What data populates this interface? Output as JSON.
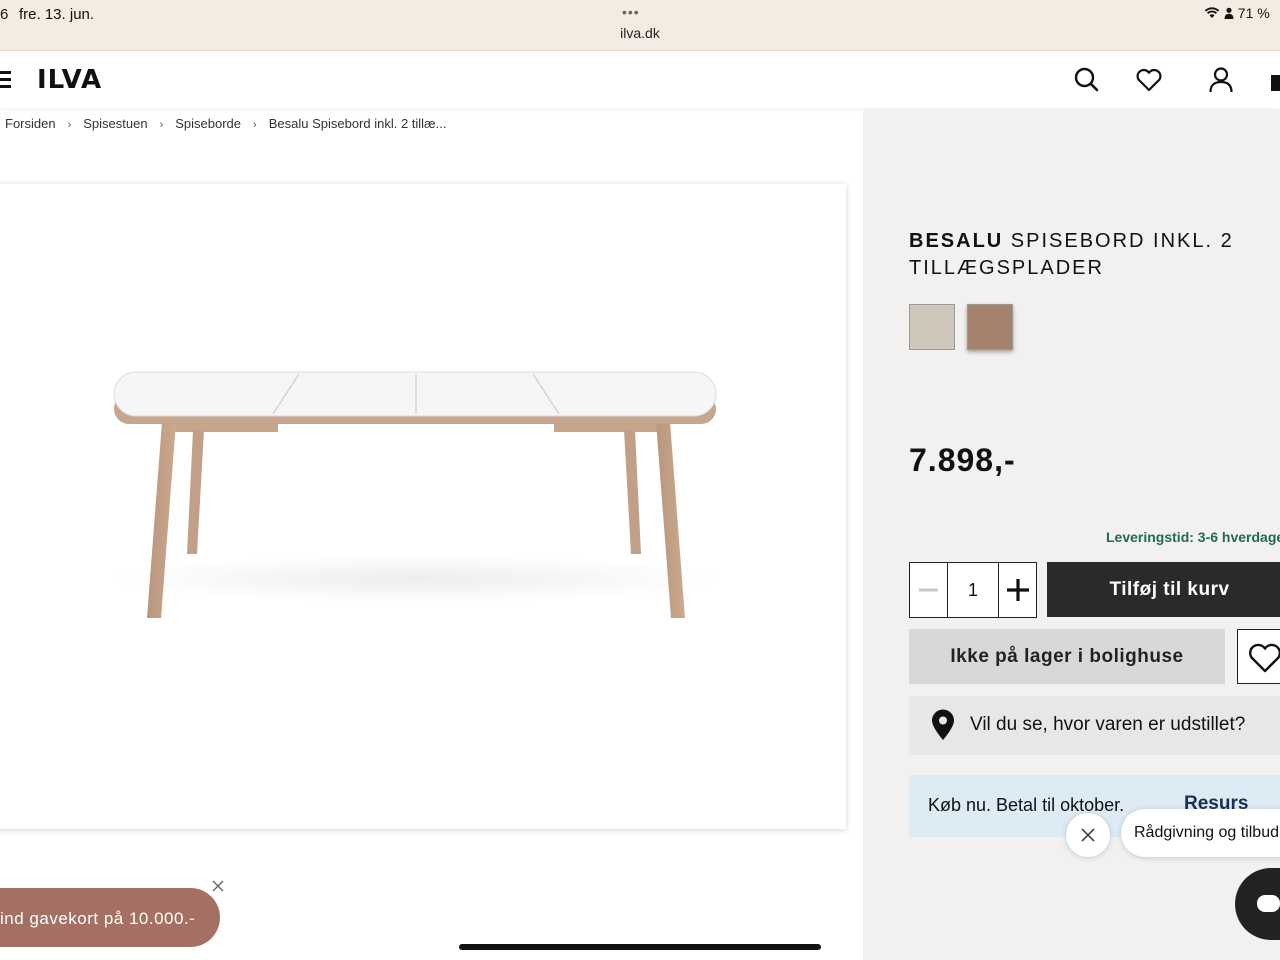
{
  "status_bar": {
    "time_fragment": "6",
    "date": "fre. 13. jun.",
    "tab_dots": "•••",
    "url": "ilva.dk",
    "battery": "71 %"
  },
  "header": {
    "logo_text": "ILVA",
    "icons": [
      "menu-icon",
      "search-icon",
      "heart-icon",
      "user-icon",
      "cart-icon"
    ]
  },
  "breadcrumb": [
    "Forsiden",
    "Spisestuen",
    "Spiseborde",
    "Besalu Spisebord inkl. 2 tillæ..."
  ],
  "breadcrumb_separator": "›",
  "product": {
    "brand": "BESALU",
    "title_rest": "SPISEBORD INKL. 2 TILLÆGSPLADER",
    "swatches": [
      {
        "name": "light",
        "color": "#cfc6ba"
      },
      {
        "name": "oak",
        "color": "#a4826d"
      }
    ],
    "price": "7.898,-",
    "delivery": "Leveringstid: 3-6 hverdage"
  },
  "actions": {
    "quantity": "1",
    "add_to_cart": "Tilføj til kurv",
    "stock": "Ikke på lager i bolighuse",
    "showroom": "Vil du se, hvor varen er udstillet?"
  },
  "financing": {
    "text": "Køb nu. Betal til oktober.",
    "provider": "Resurs"
  },
  "chat": {
    "bubble": "Rådgivning og tilbud"
  },
  "promo": {
    "text": "ind gavekort på 10.000.-"
  },
  "colors": {
    "accent_dark": "#2a2a2a",
    "delivery_green": "#1e6b56",
    "promo": "#a57064",
    "status_bar": "#f4ece2"
  }
}
